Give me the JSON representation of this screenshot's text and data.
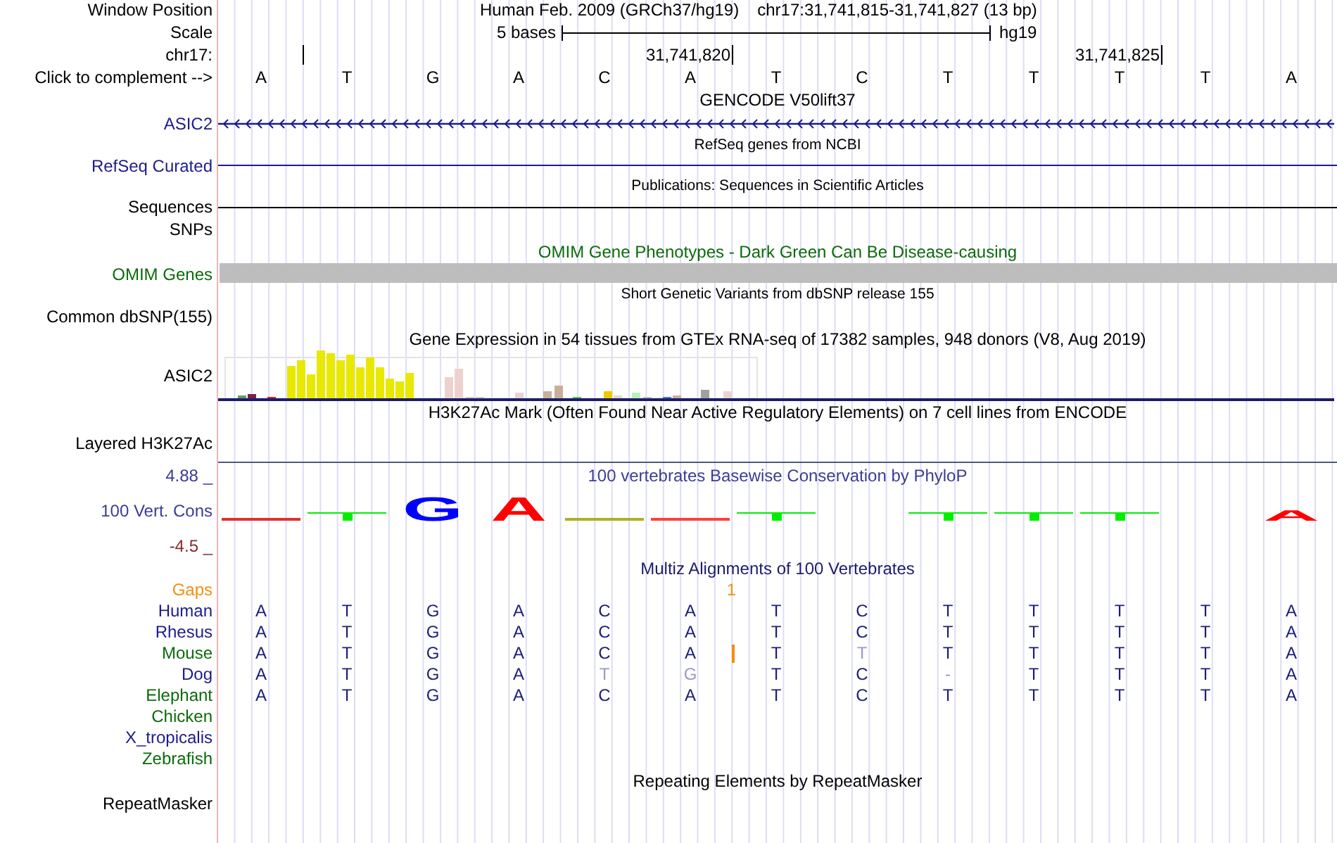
{
  "header": {
    "labels": [
      "Window Position",
      "Scale",
      "chr17:",
      "Click to complement -->"
    ],
    "assembly": "Human Feb. 2009 (GRCh37/hg19)",
    "position": "chr17:31,741,815-31,741,827 (13 bp)",
    "scale": "5 bases",
    "scale_db": "hg19",
    "ticks": [
      "31,741,820",
      "31,741,825"
    ]
  },
  "bases": [
    "A",
    "T",
    "G",
    "A",
    "C",
    "A",
    "T",
    "C",
    "T",
    "T",
    "T",
    "T",
    "A"
  ],
  "rows": [
    {
      "kind": "title",
      "text": "GENCODE V50lift37",
      "color": "#000000"
    },
    {
      "kind": "gene",
      "label": "ASIC2",
      "color": "#1c1c8c"
    },
    {
      "kind": "note",
      "text": "RefSeq genes from NCBI"
    },
    {
      "kind": "line",
      "label": "RefSeq Curated",
      "color": "#1c1c8c"
    },
    {
      "kind": "note",
      "text": "Publications: Sequences in Scientific Articles"
    },
    {
      "kind": "line",
      "label": "Sequences",
      "color": "#000000"
    },
    {
      "kind": "label",
      "label": "SNPs",
      "color": "#000000"
    },
    {
      "kind": "title",
      "text": "OMIM Gene Phenotypes - Dark Green Can Be Disease-causing",
      "color": "#0b6b0b"
    },
    {
      "kind": "bar",
      "label": "OMIM Genes",
      "color": "#0b6b0b"
    },
    {
      "kind": "note",
      "text": "Short Genetic Variants from dbSNP release 155"
    },
    {
      "kind": "label",
      "label": "Common dbSNP(155)",
      "color": "#000000"
    },
    {
      "kind": "title",
      "text": "Gene Expression in 54 tissues from GTEx RNA-seq of 17382 samples, 948 donors (V8, Aug 2019)",
      "color": "#000000"
    },
    {
      "kind": "expression",
      "label": "ASIC2",
      "color": "#000000"
    },
    {
      "kind": "title",
      "text": "H3K27Ac Mark (Often Found Near Active Regulatory Elements) on 7 cell lines from ENCODE",
      "color": "#000000"
    },
    {
      "kind": "layered",
      "label": "Layered H3K27Ac",
      "color": "#000000"
    },
    {
      "kind": "conservation",
      "title": "100 vertebrates Basewise Conservation by PhyloP",
      "label": "100 Vert. Cons",
      "max": "4.88 _",
      "min": "-4.5 _",
      "color": "#3c3c96",
      "logo": [
        {
          "kind": "flat",
          "color": "#e03030"
        },
        {
          "kind": "tick",
          "color": "#00ee00"
        },
        {
          "kind": "letter",
          "text": "G",
          "color": "#0000ff"
        },
        {
          "kind": "letter",
          "text": "A",
          "color": "#ff0000"
        },
        {
          "kind": "flat",
          "color": "#b0b020"
        },
        {
          "kind": "flat",
          "color": "#ff4040"
        },
        {
          "kind": "tick",
          "color": "#00ee00"
        },
        {
          "kind": "none"
        },
        {
          "kind": "tick",
          "color": "#00ee00"
        },
        {
          "kind": "tick",
          "color": "#00ee00"
        },
        {
          "kind": "tick",
          "color": "#00ee00"
        },
        {
          "kind": "none"
        },
        {
          "kind": "squashed",
          "text": "A",
          "color": "#ff0000"
        }
      ]
    },
    {
      "kind": "multiz",
      "title": "Multiz Alignments of 100 Vertebrates",
      "color": "#1c1c6c",
      "gaps": {
        "label": "Gaps",
        "count": "1"
      },
      "species": [
        {
          "name": "Human",
          "color": "#1c1c8c",
          "bases": [
            "A",
            "T",
            "G",
            "A",
            "C",
            "A",
            "T",
            "C",
            "T",
            "T",
            "T",
            "T",
            "A"
          ]
        },
        {
          "name": "Rhesus",
          "color": "#1c1c8c",
          "bases": [
            "A",
            "T",
            "G",
            "A",
            "C",
            "A",
            "T",
            "C",
            "T",
            "T",
            "T",
            "T",
            "A"
          ]
        },
        {
          "name": "Mouse",
          "color": "#0b6b0b",
          "bases": [
            "A",
            "T",
            "G",
            "A",
            "C",
            "A",
            "T",
            "T",
            "T",
            "T",
            "T",
            "T",
            "A"
          ],
          "faded": [
            false,
            false,
            false,
            false,
            false,
            false,
            false,
            true,
            false,
            false,
            false,
            false,
            false
          ],
          "insert": true
        },
        {
          "name": "Dog",
          "color": "#1c1c8c",
          "bases": [
            "A",
            "T",
            "G",
            "A",
            "T",
            "G",
            "T",
            "C",
            "-",
            "T",
            "T",
            "T",
            "A"
          ],
          "faded": [
            false,
            false,
            false,
            false,
            true,
            true,
            false,
            false,
            true,
            false,
            false,
            false,
            false
          ]
        },
        {
          "name": "Elephant",
          "color": "#0b6b0b",
          "bases": [
            "A",
            "T",
            "G",
            "A",
            "C",
            "A",
            "T",
            "C",
            "T",
            "T",
            "T",
            "T",
            "A"
          ]
        },
        {
          "name": "Chicken",
          "color": "#0b6b0b"
        },
        {
          "name": "X_tropicalis",
          "color": "#1c1c8c"
        },
        {
          "name": "Zebrafish",
          "color": "#0b6b0b"
        }
      ]
    },
    {
      "kind": "title",
      "text": "Repeating Elements by RepeatMasker",
      "color": "#000000"
    },
    {
      "kind": "label",
      "label": "RepeatMasker",
      "color": "#000000"
    }
  ]
}
